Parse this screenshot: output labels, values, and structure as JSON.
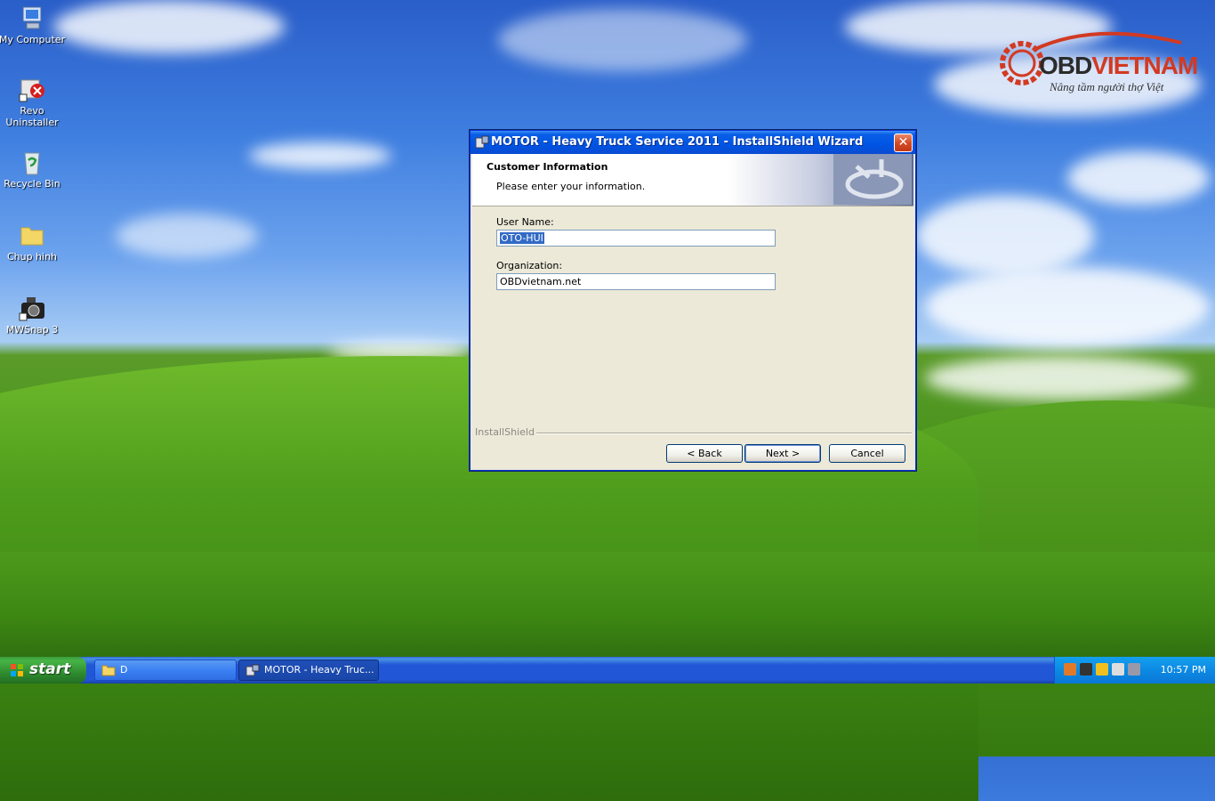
{
  "desktop": {
    "icons": [
      {
        "label": "My Computer"
      },
      {
        "label": "Revo Uninstaller"
      },
      {
        "label": "Recycle Bin"
      },
      {
        "label": "Chup hinh"
      },
      {
        "label": "MWSnap 3"
      }
    ]
  },
  "logo": {
    "brand_a": "OBD",
    "brand_b": "VIETNAM",
    "tagline": "Nâng tầm người thợ Việt"
  },
  "dialog": {
    "title": "MOTOR - Heavy Truck Service 2011 - InstallShield Wizard",
    "close_symbol": "✕",
    "banner_title": "Customer Information",
    "banner_subtitle": "Please enter your information.",
    "user_name_label": "User Name:",
    "user_name_value": "OTO-HUI",
    "organization_label": "Organization:",
    "organization_value": "OBDvietnam.net",
    "brand_label": "InstallShield",
    "back_label": "< Back",
    "next_label": "Next >",
    "cancel_label": "Cancel"
  },
  "taskbar": {
    "start_label": "start",
    "items": [
      {
        "label": "D"
      },
      {
        "label": "MOTOR - Heavy Truc..."
      }
    ],
    "clock": "10:57 PM"
  },
  "colors": {
    "title_blue": "#0054e3",
    "dialog_face": "#ece9d8",
    "selection": "#316ac5",
    "logo_red": "#d23a22"
  }
}
